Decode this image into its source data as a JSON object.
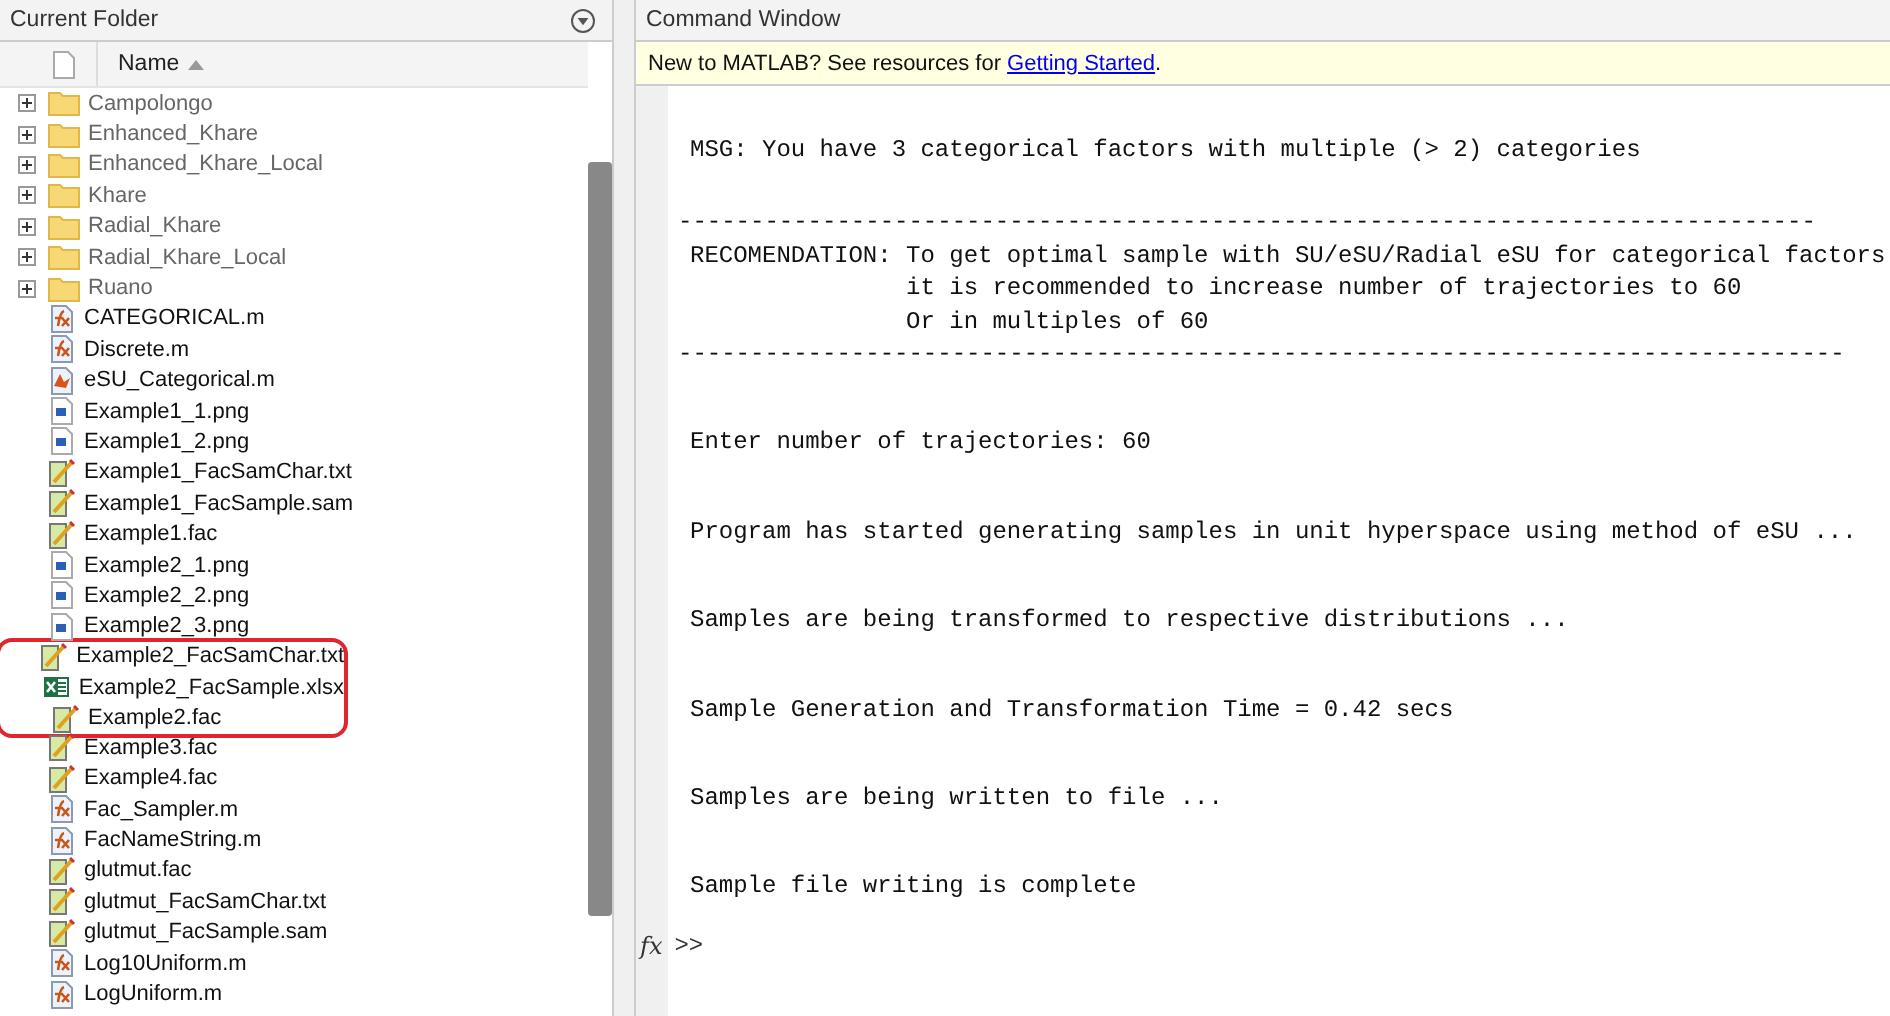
{
  "folder_panel": {
    "title": "Current Folder",
    "column": "Name",
    "items": [
      {
        "name": "Campolongo",
        "kind": "folder",
        "expanded": false,
        "circled": false
      },
      {
        "name": "Enhanced_Khare",
        "kind": "folder",
        "expanded": false,
        "circled": false
      },
      {
        "name": "Enhanced_Khare_Local",
        "kind": "folder",
        "expanded": false,
        "circled": false
      },
      {
        "name": "Khare",
        "kind": "folder",
        "expanded": false,
        "circled": false
      },
      {
        "name": "Radial_Khare",
        "kind": "folder",
        "expanded": false,
        "circled": false
      },
      {
        "name": "Radial_Khare_Local",
        "kind": "folder",
        "expanded": false,
        "circled": false
      },
      {
        "name": "Ruano",
        "kind": "folder",
        "expanded": false,
        "circled": false
      },
      {
        "name": "CATEGORICAL.m",
        "kind": "function",
        "circled": false
      },
      {
        "name": "Discrete.m",
        "kind": "function",
        "circled": false
      },
      {
        "name": "eSU_Categorical.m",
        "kind": "script",
        "circled": false
      },
      {
        "name": "Example1_1.png",
        "kind": "image",
        "circled": false
      },
      {
        "name": "Example1_2.png",
        "kind": "image",
        "circled": false
      },
      {
        "name": "Example1_FacSamChar.txt",
        "kind": "text",
        "circled": false
      },
      {
        "name": "Example1_FacSample.sam",
        "kind": "text",
        "circled": false
      },
      {
        "name": "Example1.fac",
        "kind": "text",
        "circled": false
      },
      {
        "name": "Example2_1.png",
        "kind": "image",
        "circled": false
      },
      {
        "name": "Example2_2.png",
        "kind": "image",
        "circled": false
      },
      {
        "name": "Example2_3.png",
        "kind": "image",
        "circled": false
      },
      {
        "name": "Example2_FacSamChar.txt",
        "kind": "text",
        "circled": true
      },
      {
        "name": "Example2_FacSample.xlsx",
        "kind": "spreadsheet",
        "circled": true
      },
      {
        "name": "Example2.fac",
        "kind": "text",
        "circled": true
      },
      {
        "name": "Example3.fac",
        "kind": "text",
        "circled": false
      },
      {
        "name": "Example4.fac",
        "kind": "text",
        "circled": false
      },
      {
        "name": "Fac_Sampler.m",
        "kind": "function",
        "circled": false
      },
      {
        "name": "FacNameString.m",
        "kind": "function",
        "circled": false
      },
      {
        "name": "glutmut.fac",
        "kind": "text",
        "circled": false
      },
      {
        "name": "glutmut_FacSamChar.txt",
        "kind": "text",
        "circled": false
      },
      {
        "name": "glutmut_FacSample.sam",
        "kind": "text",
        "circled": false
      },
      {
        "name": "Log10Uniform.m",
        "kind": "function",
        "circled": false
      },
      {
        "name": "LogUniform.m",
        "kind": "function",
        "circled": false
      }
    ]
  },
  "command_window": {
    "title": "Command Window",
    "banner": {
      "text": "New to MATLAB? See resources for ",
      "link": "Getting Started",
      "after": "."
    },
    "output": [
      [
        "MSG: You have 3 categorical factors with multiple (> 2) categories"
      ],
      [
        "-------------------------------------------------------------------------------",
        "RECOMENDATION: To get optimal sample with SU/eSU/Radial eSU for categorical factors",
        "               it is recommended to increase number of trajectories to 60",
        "               Or in multiples of 60",
        "---------------------------------------------------------------------------------"
      ],
      [
        "Enter number of trajectories: 60"
      ],
      [
        "Program has started generating samples in unit hyperspace using method of eSU ..."
      ],
      [
        "Samples are being transformed to respective distributions ..."
      ],
      [
        "Sample Generation and Transformation Time = 0.42 secs"
      ],
      [
        "Samples are being written to file ..."
      ],
      [
        "Sample file writing is complete"
      ]
    ],
    "prompt": {
      "symbol": "fx",
      "text": ">>"
    }
  }
}
